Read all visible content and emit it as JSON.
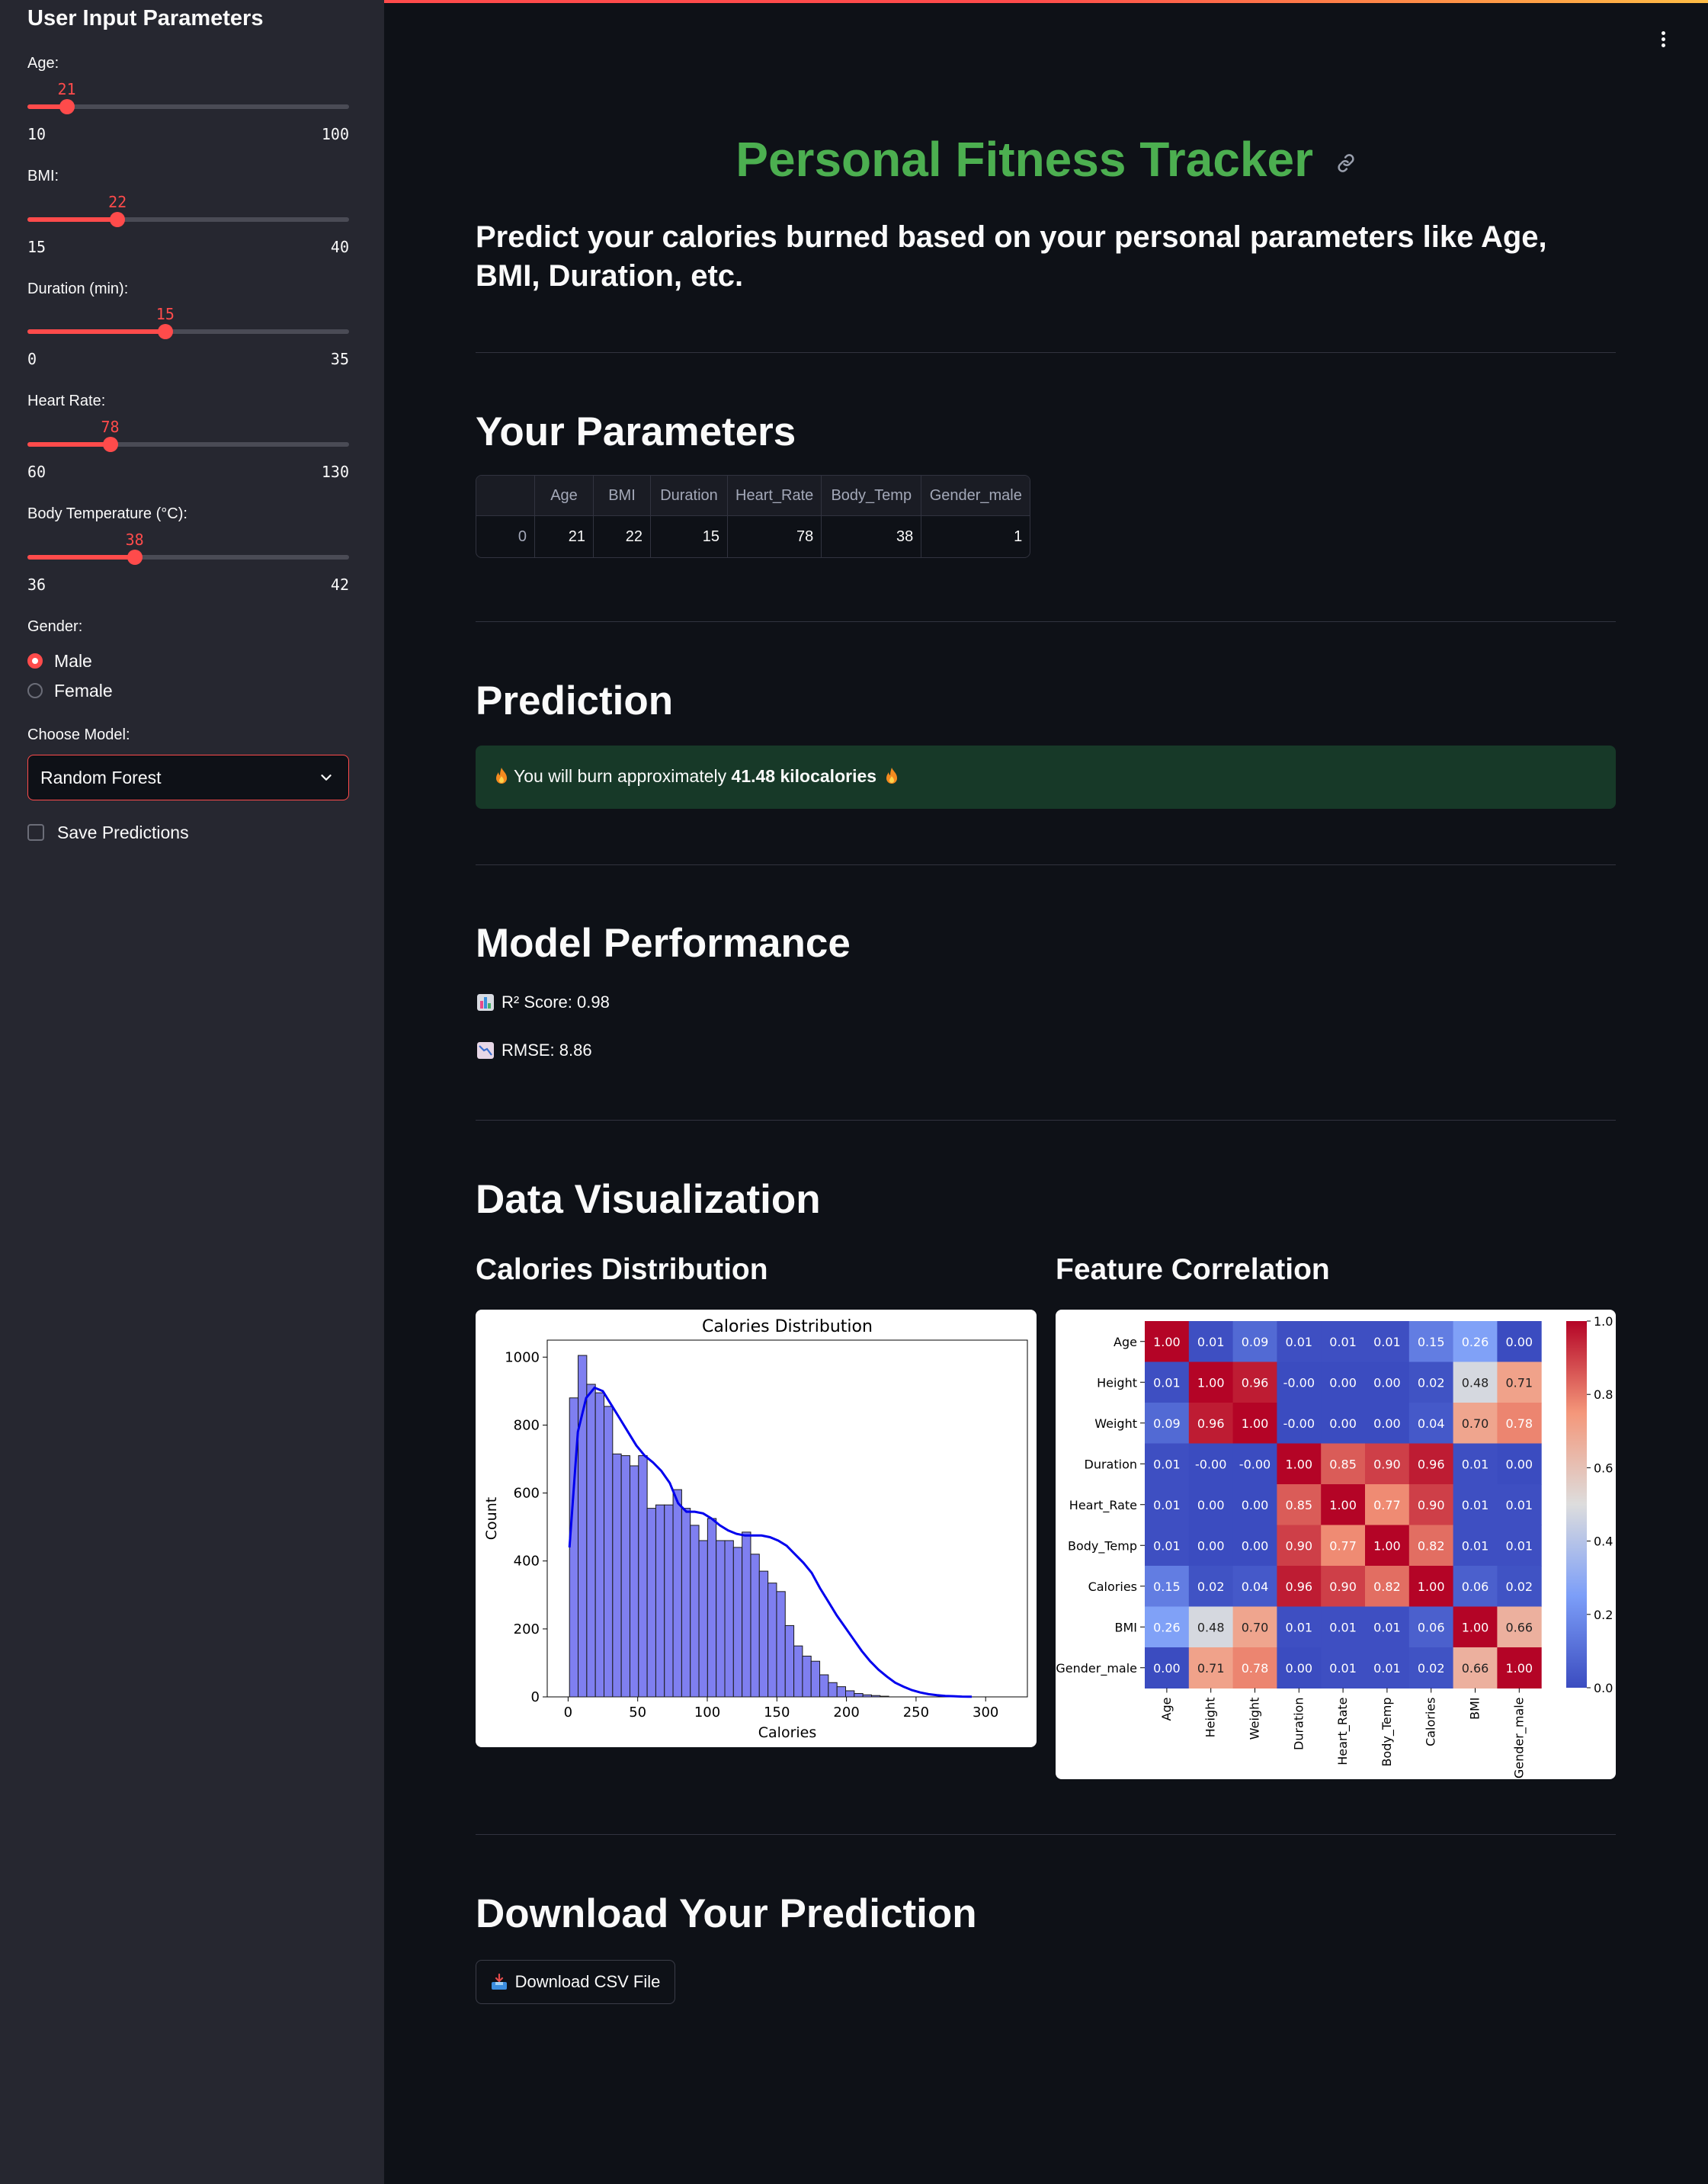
{
  "sidebar": {
    "title": "User Input Parameters",
    "sliders": [
      {
        "label": "Age:",
        "value": 21,
        "min": 10,
        "max": 100
      },
      {
        "label": "BMI:",
        "value": 22,
        "min": 15,
        "max": 40
      },
      {
        "label": "Duration (min):",
        "value": 15,
        "min": 0,
        "max": 35
      },
      {
        "label": "Heart Rate:",
        "value": 78,
        "min": 60,
        "max": 130
      },
      {
        "label": "Body Temperature (°C):",
        "value": 38,
        "min": 36,
        "max": 42
      }
    ],
    "gender": {
      "label": "Gender:",
      "options": [
        "Male",
        "Female"
      ],
      "selected": "Male"
    },
    "model": {
      "label": "Choose Model:",
      "value": "Random Forest"
    },
    "save_label": "Save Predictions",
    "save_checked": false
  },
  "header": {
    "title": "Personal Fitness Tracker",
    "subtitle": "Predict your calories burned based on your personal parameters like Age, BMI, Duration, etc."
  },
  "parameters": {
    "heading": "Your Parameters",
    "columns": [
      "",
      "Age",
      "BMI",
      "Duration",
      "Heart_Rate",
      "Body_Temp",
      "Gender_male"
    ],
    "rows": [
      [
        "0",
        "21",
        "22",
        "15",
        "78",
        "38",
        "1"
      ]
    ]
  },
  "prediction": {
    "heading": "Prediction",
    "prefix": "You will burn approximately",
    "value": "41.48 kilocalories"
  },
  "performance": {
    "heading": "Model Performance",
    "r2": "R² Score: 0.98",
    "rmse": "RMSE: 8.86"
  },
  "visualization": {
    "heading": "Data Visualization",
    "left_heading": "Calories Distribution",
    "right_heading": "Feature Correlation"
  },
  "download": {
    "heading": "Download Your Prediction",
    "button_label": "Download CSV File"
  },
  "colors": {
    "accent": "#ff4b4b",
    "title_green": "#4caf50",
    "success_bg": "#173928",
    "hist_fill": "#7f7ff0",
    "kde_line": "#0000ee"
  },
  "chart_data": [
    {
      "type": "bar",
      "title": "Calories Distribution",
      "xlabel": "Calories",
      "ylabel": "Count",
      "xlim": [
        -15,
        330
      ],
      "ylim": [
        0,
        1050
      ],
      "xticks": [
        0,
        50,
        100,
        150,
        200,
        250,
        300
      ],
      "yticks": [
        0,
        200,
        400,
        600,
        800,
        1000
      ],
      "bin_start": 1,
      "bin_width": 6.2,
      "values": [
        880,
        1005,
        920,
        895,
        855,
        715,
        710,
        680,
        710,
        555,
        565,
        565,
        610,
        555,
        505,
        460,
        525,
        460,
        460,
        440,
        485,
        420,
        370,
        335,
        310,
        210,
        150,
        120,
        105,
        65,
        42,
        30,
        18,
        10,
        6,
        4,
        2
      ],
      "kde": [
        [
          1,
          440
        ],
        [
          7,
          780
        ],
        [
          13,
          880
        ],
        [
          19,
          910
        ],
        [
          25,
          900
        ],
        [
          31,
          860
        ],
        [
          37,
          820
        ],
        [
          43,
          780
        ],
        [
          49,
          740
        ],
        [
          55,
          710
        ],
        [
          61,
          690
        ],
        [
          67,
          665
        ],
        [
          73,
          630
        ],
        [
          79,
          570
        ],
        [
          85,
          545
        ],
        [
          91,
          545
        ],
        [
          97,
          540
        ],
        [
          103,
          525
        ],
        [
          109,
          505
        ],
        [
          115,
          490
        ],
        [
          121,
          480
        ],
        [
          127,
          475
        ],
        [
          133,
          475
        ],
        [
          139,
          475
        ],
        [
          145,
          470
        ],
        [
          151,
          460
        ],
        [
          157,
          445
        ],
        [
          163,
          420
        ],
        [
          169,
          395
        ],
        [
          175,
          365
        ],
        [
          181,
          320
        ],
        [
          187,
          280
        ],
        [
          193,
          240
        ],
        [
          199,
          205
        ],
        [
          205,
          170
        ],
        [
          211,
          135
        ],
        [
          217,
          105
        ],
        [
          223,
          80
        ],
        [
          229,
          60
        ],
        [
          235,
          42
        ],
        [
          241,
          30
        ],
        [
          247,
          20
        ],
        [
          253,
          13
        ],
        [
          259,
          8
        ],
        [
          265,
          5
        ],
        [
          271,
          3
        ],
        [
          277,
          2
        ],
        [
          283,
          1
        ],
        [
          290,
          0.5
        ]
      ]
    },
    {
      "type": "heatmap",
      "labels": [
        "Age",
        "Height",
        "Weight",
        "Duration",
        "Heart_Rate",
        "Body_Temp",
        "Calories",
        "BMI",
        "Gender_male"
      ],
      "matrix": [
        [
          1.0,
          0.01,
          0.09,
          0.01,
          0.01,
          0.01,
          0.15,
          0.26,
          0.0
        ],
        [
          0.01,
          1.0,
          0.96,
          -0.0,
          0.0,
          0.0,
          0.02,
          0.48,
          0.71
        ],
        [
          0.09,
          0.96,
          1.0,
          -0.0,
          0.0,
          0.0,
          0.04,
          0.7,
          0.78
        ],
        [
          0.01,
          -0.0,
          -0.0,
          1.0,
          0.85,
          0.9,
          0.96,
          0.01,
          0.0
        ],
        [
          0.01,
          0.0,
          0.0,
          0.85,
          1.0,
          0.77,
          0.9,
          0.01,
          0.01
        ],
        [
          0.01,
          0.0,
          0.0,
          0.9,
          0.77,
          1.0,
          0.82,
          0.01,
          0.01
        ],
        [
          0.15,
          0.02,
          0.04,
          0.96,
          0.9,
          0.82,
          1.0,
          0.06,
          0.02
        ],
        [
          0.26,
          0.48,
          0.7,
          0.01,
          0.01,
          0.01,
          0.06,
          1.0,
          0.66
        ],
        [
          0.0,
          0.71,
          0.78,
          0.0,
          0.01,
          0.01,
          0.02,
          0.66,
          1.0
        ]
      ],
      "cell_text": [
        [
          "1.00",
          "0.01",
          "0.09",
          "0.01",
          "0.01",
          "0.01",
          "0.15",
          "0.26",
          "0.00"
        ],
        [
          "0.01",
          "1.00",
          "0.96",
          "-0.00",
          "0.00",
          "0.00",
          "0.02",
          "0.48",
          "0.71"
        ],
        [
          "0.09",
          "0.96",
          "1.00",
          "-0.00",
          "0.00",
          "0.00",
          "0.04",
          "0.70",
          "0.78"
        ],
        [
          "0.01",
          "-0.00",
          "-0.00",
          "1.00",
          "0.85",
          "0.90",
          "0.96",
          "0.01",
          "0.00"
        ],
        [
          "0.01",
          "0.00",
          "0.00",
          "0.85",
          "1.00",
          "0.77",
          "0.90",
          "0.01",
          "0.01"
        ],
        [
          "0.01",
          "0.00",
          "0.00",
          "0.90",
          "0.77",
          "1.00",
          "0.82",
          "0.01",
          "0.01"
        ],
        [
          "0.15",
          "0.02",
          "0.04",
          "0.96",
          "0.90",
          "0.82",
          "1.00",
          "0.06",
          "0.02"
        ],
        [
          "0.26",
          "0.48",
          "0.70",
          "0.01",
          "0.01",
          "0.01",
          "0.06",
          "1.00",
          "0.66"
        ],
        [
          "0.00",
          "0.71",
          "0.78",
          "0.00",
          "0.01",
          "0.01",
          "0.02",
          "0.66",
          "1.00"
        ]
      ],
      "colorbar_ticks": [
        "0.0",
        "0.2",
        "0.4",
        "0.6",
        "0.8",
        "1.0"
      ],
      "vmin": 0,
      "vmax": 1,
      "colormap": "coolwarm"
    }
  ]
}
